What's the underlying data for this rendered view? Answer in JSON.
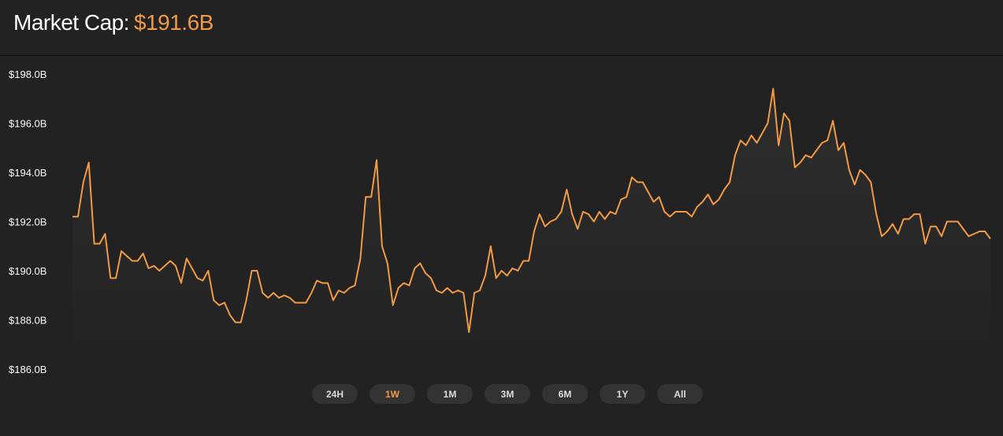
{
  "header": {
    "title_label": "Market Cap:",
    "title_value": "$191.6B"
  },
  "colors": {
    "background": "#222222",
    "accent": "#f29a43",
    "button_bg": "#333333"
  },
  "ranges": {
    "items": [
      "24H",
      "1W",
      "1M",
      "3M",
      "6M",
      "1Y",
      "All"
    ],
    "active": "1W"
  },
  "chart_data": {
    "type": "area",
    "title": "",
    "xlabel": "",
    "ylabel": "",
    "ylim": [
      186.0,
      198.0
    ],
    "yticks": [
      198.0,
      196.0,
      194.0,
      192.0,
      190.0,
      188.0,
      186.0
    ],
    "ytick_labels": [
      "$198.0B",
      "$196.0B",
      "$194.0B",
      "$192.0B",
      "$190.0B",
      "$188.0B",
      "$186.0B"
    ],
    "grid": false,
    "legend": "none",
    "series": [
      {
        "color": "#f29a43",
        "values": [
          192.2,
          192.2,
          193.6,
          194.4,
          191.1,
          191.1,
          191.5,
          189.7,
          189.7,
          190.8,
          190.6,
          190.4,
          190.4,
          190.7,
          190.1,
          190.2,
          190.0,
          190.2,
          190.4,
          190.2,
          189.5,
          190.5,
          190.1,
          189.7,
          189.6,
          190.0,
          188.8,
          188.6,
          188.7,
          188.2,
          187.9,
          187.9,
          188.8,
          190.0,
          190.0,
          189.1,
          188.9,
          189.1,
          188.9,
          189.0,
          188.9,
          188.7,
          188.7,
          188.7,
          189.1,
          189.6,
          189.5,
          189.5,
          188.8,
          189.2,
          189.1,
          189.3,
          189.4,
          190.5,
          193.0,
          193.0,
          194.5,
          191.0,
          190.3,
          188.6,
          189.3,
          189.5,
          189.4,
          190.1,
          190.3,
          189.9,
          189.7,
          189.2,
          189.1,
          189.3,
          189.1,
          189.2,
          189.1,
          187.5,
          189.1,
          189.2,
          189.8,
          191.0,
          189.7,
          190.0,
          189.8,
          190.1,
          190.0,
          190.4,
          190.4,
          191.6,
          192.3,
          191.8,
          192.0,
          192.1,
          192.4,
          193.3,
          192.3,
          191.7,
          192.4,
          192.3,
          192.0,
          192.4,
          192.1,
          192.4,
          192.3,
          192.9,
          193.0,
          193.8,
          193.6,
          193.6,
          193.2,
          192.8,
          193.0,
          192.4,
          192.2,
          192.4,
          192.4,
          192.4,
          192.2,
          192.6,
          192.8,
          193.1,
          192.7,
          192.9,
          193.3,
          193.6,
          194.7,
          195.3,
          195.1,
          195.5,
          195.2,
          195.6,
          196.0,
          197.4,
          195.1,
          196.4,
          196.1,
          194.2,
          194.4,
          194.7,
          194.6,
          194.9,
          195.2,
          195.3,
          196.1,
          194.9,
          195.2,
          194.1,
          193.5,
          194.1,
          193.9,
          193.6,
          192.3,
          191.4,
          191.6,
          191.9,
          191.5,
          192.1,
          192.1,
          192.3,
          192.3,
          191.1,
          191.8,
          191.8,
          191.4,
          192.0,
          192.0,
          192.0,
          191.7,
          191.4,
          191.5,
          191.6,
          191.6,
          191.3
        ]
      }
    ]
  }
}
